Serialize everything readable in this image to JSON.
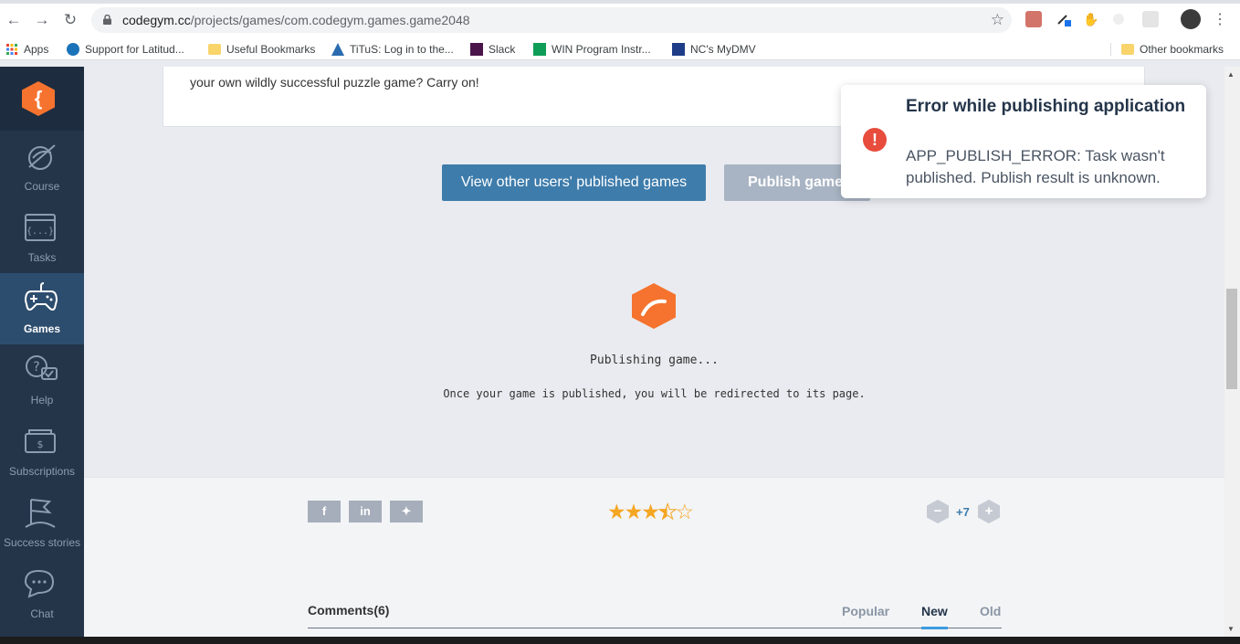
{
  "browser": {
    "url_host": "codegym.cc",
    "url_path": "/projects/games/com.codegym.games.game2048",
    "bookmarks": [
      {
        "label": "Apps"
      },
      {
        "label": "Support for Latitud..."
      },
      {
        "label": "Useful Bookmarks"
      },
      {
        "label": "TiTuS: Log in to the..."
      },
      {
        "label": "Slack"
      },
      {
        "label": "WIN Program Instr..."
      },
      {
        "label": "NC's MyDMV"
      }
    ],
    "other_bookmarks": "Other bookmarks"
  },
  "sidebar": {
    "items": [
      {
        "label": "Course",
        "icon": "course-icon"
      },
      {
        "label": "Tasks",
        "icon": "tasks-icon"
      },
      {
        "label": "Games",
        "icon": "gamepad-icon",
        "active": true
      },
      {
        "label": "Help",
        "icon": "help-icon"
      },
      {
        "label": "Subscriptions",
        "icon": "subscriptions-icon"
      },
      {
        "label": "Success stories",
        "icon": "flag-icon"
      },
      {
        "label": "Chat",
        "icon": "chat-icon"
      }
    ]
  },
  "main": {
    "desc_text": "your own wildly successful puzzle game? Carry on!",
    "view_button": "View other users' published games",
    "publish_button": "Publish game",
    "publishing_title": "Publishing game...",
    "publishing_sub": "Once your game is published, you will be redirected to its page.",
    "rating": 3.5,
    "score": "+7",
    "comments_title": "Comments(6)",
    "sort_popular": "Popular",
    "sort_new": "New",
    "sort_old": "Old"
  },
  "toast": {
    "title": "Error while publishing application",
    "message": "APP_PUBLISH_ERROR: Task wasn't published. Publish result is unknown.",
    "icon": "error-icon",
    "color": "#e74c3c"
  }
}
